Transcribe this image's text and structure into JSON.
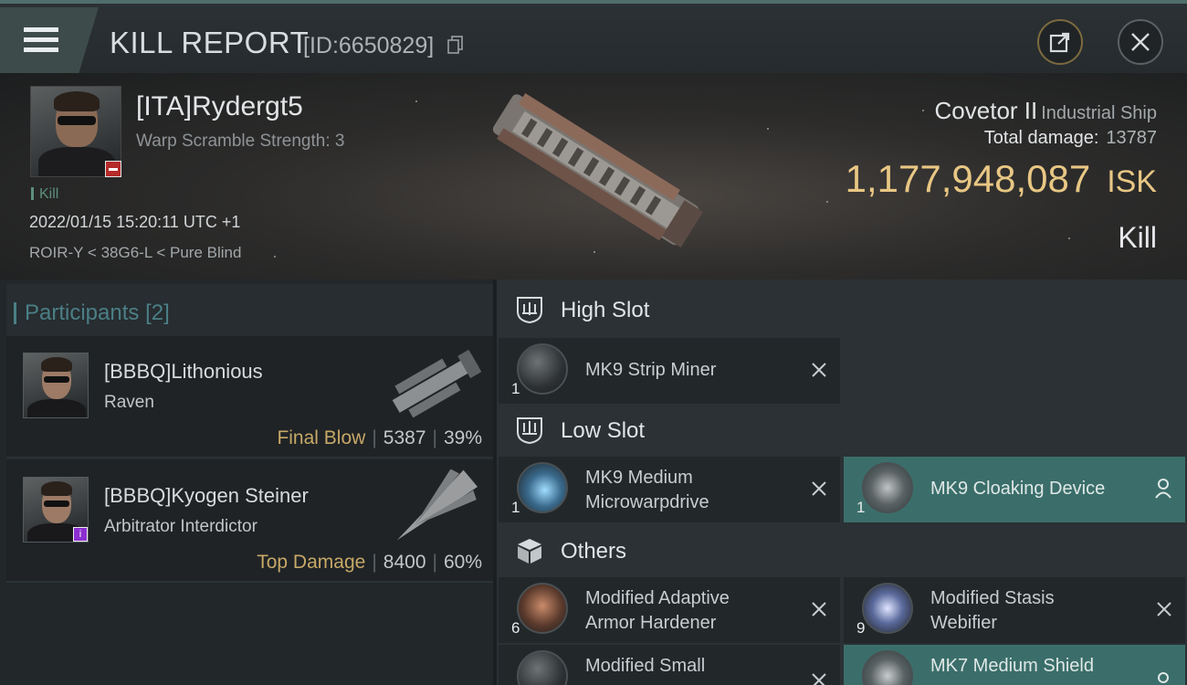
{
  "header": {
    "title": "KILL REPORT",
    "id_label": "[ID:6650829]"
  },
  "victim": {
    "name": "[ITA]Rydergt5",
    "warp_scramble": "Warp Scramble Strength: 3",
    "kill_tag": "Kill",
    "datetime": "2022/01/15 15:20:11 UTC +1",
    "location": "ROIR-Y < 38G6-L < Pure Blind"
  },
  "ship": {
    "name": "Covetor II",
    "class": "Industrial Ship",
    "total_damage_label": "Total damage:",
    "total_damage": "13787",
    "isk_value": "1,177,948,087",
    "isk_unit": "ISK",
    "result": "Kill"
  },
  "participants": {
    "title": "Participants",
    "count": "[2]",
    "items": [
      {
        "name": "[BBBQ]Lithonious",
        "ship": "Raven",
        "tag": "Final Blow",
        "damage": "5387",
        "percent": "39%"
      },
      {
        "name": "[BBBQ]Kyogen Steiner",
        "ship": "Arbitrator Interdictor",
        "tag": "Top Damage",
        "damage": "8400",
        "percent": "60%"
      }
    ]
  },
  "fitting": {
    "high_slot": {
      "title": "High Slot",
      "items": [
        {
          "line1": "MK9 Strip Miner",
          "line2": "",
          "qty": "1"
        }
      ]
    },
    "low_slot": {
      "title": "Low Slot",
      "items": [
        {
          "line1": "MK9 Medium",
          "line2": "Microwarpdrive",
          "qty": "1"
        },
        {
          "line1": "MK9 Cloaking Device",
          "line2": "",
          "qty": "1"
        }
      ]
    },
    "others": {
      "title": "Others",
      "items": [
        {
          "line1": "Modified Adaptive",
          "line2": "Armor Hardener",
          "qty": "6"
        },
        {
          "line1": "Modified Stasis",
          "line2": "Webifier",
          "qty": "9"
        },
        {
          "line1": "Modified Small",
          "line2": "",
          "qty": ""
        },
        {
          "line1": "MK7 Medium Shield",
          "line2": "",
          "qty": ""
        }
      ]
    }
  },
  "colors": {
    "accent_teal": "#4b7f86",
    "isk_gold": "#e8c784",
    "highlight_slot": "#3b6e6a"
  }
}
